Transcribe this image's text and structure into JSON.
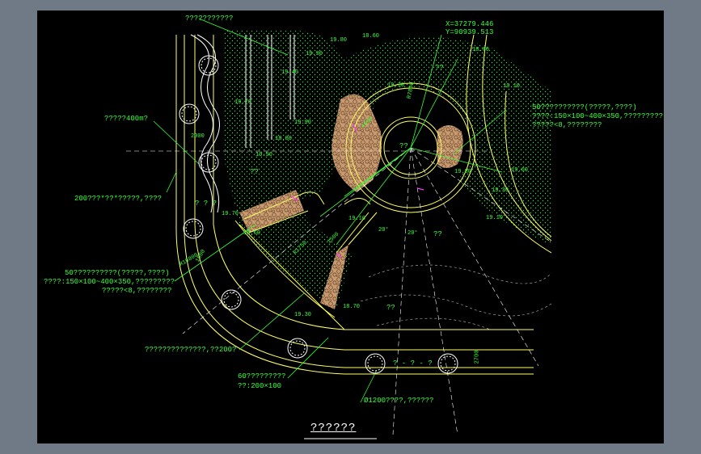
{
  "title": "??????",
  "coords": {
    "x": "X=37279.446",
    "y": "Y=90939.513"
  },
  "notes": {
    "top_left": "???????????",
    "area": "?????400m?",
    "border_200": "200???*??*?????,????",
    "paving_left_1": "50??????????(?????,????)",
    "paving_left_2": "????:150×100~400×350,?????????",
    "paving_left_3": "?????<8,????????",
    "paving_right_1": "50??????????(?????,????)",
    "paving_right_2": "????:150×100~400×350,?????????",
    "paving_right_3": "?????<8,????????",
    "curb": "??????????????,??200?",
    "edge_1": "60?????????",
    "edge_2": "??:200×100",
    "tree": "Ø1200????,??????",
    "qmarks_a": "? ? ?",
    "qmarks_b": "? - ? - ?",
    "qmarks_c": "??",
    "qmarks_d": "??",
    "qmarks_e": "??",
    "qmarks_f": "??",
    "qmarks_g": "??"
  },
  "levels": [
    "18.60",
    "18.60",
    "19.80",
    "19.90",
    "19.40",
    "19.70",
    "19.90",
    "18.80",
    "19.90",
    "19.30",
    "19.10",
    "19.10",
    "19.70",
    "19.60",
    "19.30",
    "19.10",
    "19.30",
    "18.70",
    "18.60",
    "19.80"
  ],
  "dims": {
    "r1": "R7800",
    "r2": "R1750",
    "r3": "R16800",
    "a1": "20°",
    "a2": "20°",
    "d1": "2700",
    "d2": "2000",
    "d3": "4500",
    "d4": "1500",
    "d5": "1500"
  }
}
